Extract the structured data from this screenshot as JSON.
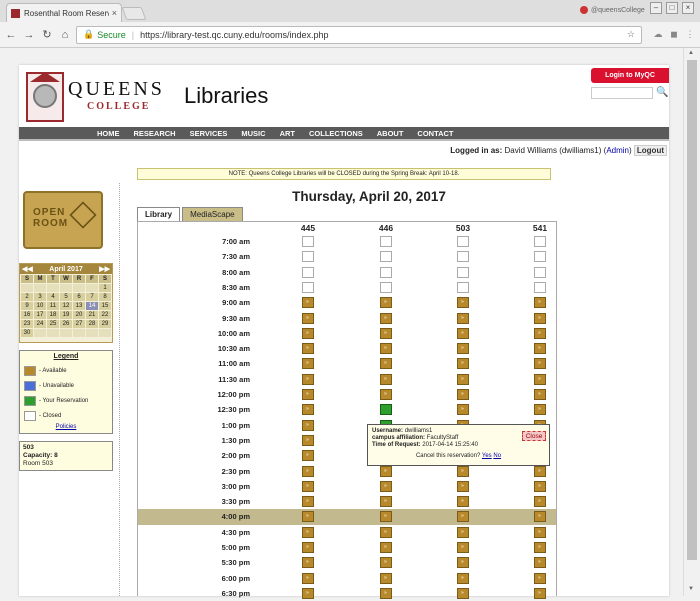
{
  "browser": {
    "tab_title": "Rosenthal Room Reservation",
    "tab_close": "×",
    "profile_name": "@queensCollege",
    "secure_label": "Secure",
    "url": "https://library-test.qc.cuny.edu/rooms/index.php",
    "icons": [
      "back-icon",
      "forward-icon",
      "reload-icon",
      "home-icon",
      "lock-icon",
      "star-icon",
      "menu-icon"
    ]
  },
  "header": {
    "logo_queens": "QUEENS",
    "logo_college": "COLLEGE",
    "site_title": "Libraries",
    "login_button": "Login to MyQC",
    "search_placeholder": ""
  },
  "nav": [
    "HOME",
    "RESEARCH",
    "SERVICES",
    "MUSIC",
    "ART",
    "COLLECTIONS",
    "ABOUT",
    "CONTACT"
  ],
  "user": {
    "logged_in_label": "Logged in as:",
    "user_name": "David Williams (dwilliams1)",
    "admin_link": "Admin",
    "logout": "Logout"
  },
  "notice": "NOTE: Queens College Libraries will be CLOSED during the Spring Break: April 10-18.",
  "open_room": {
    "line1": "OPEN",
    "line2": "ROOM"
  },
  "calendar": {
    "month_label": "April 2017",
    "prev": "◀◀",
    "next": "▶▶",
    "dow": [
      "S",
      "M",
      "T",
      "W",
      "R",
      "F",
      "S"
    ],
    "weeks": [
      [
        "",
        "",
        "",
        "",
        "",
        "",
        "1"
      ],
      [
        "2",
        "3",
        "4",
        "5",
        "6",
        "7",
        "8"
      ],
      [
        "9",
        "10",
        "11",
        "12",
        "13",
        "14",
        "15"
      ],
      [
        "16",
        "17",
        "18",
        "19",
        "20",
        "21",
        "22"
      ],
      [
        "23",
        "24",
        "25",
        "26",
        "27",
        "28",
        "29"
      ],
      [
        "30",
        "",
        "",
        "",
        "",
        "",
        ""
      ]
    ],
    "today": "14"
  },
  "legend": {
    "title": "Legend",
    "items": [
      {
        "label": "- Available",
        "color": "#b8892b"
      },
      {
        "label": "- Unavailable",
        "color": "#4a6fd8"
      },
      {
        "label": "- Your Reservation",
        "color": "#2e9e2e"
      },
      {
        "label": "- Closed",
        "color": "#ffffff"
      }
    ],
    "policies_link": "Policies"
  },
  "room_info": {
    "room": "503",
    "capacity": "Capacity: 8",
    "location": "Room 503"
  },
  "date_heading": "Thursday, April 20, 2017",
  "tabs": [
    {
      "label": "Library",
      "active": true
    },
    {
      "label": "MediaScape",
      "active": false
    }
  ],
  "rooms": [
    "445",
    "446",
    "503",
    "541"
  ],
  "slots": [
    {
      "time": "7:00 am",
      "states": [
        "closed",
        "closed",
        "closed",
        "closed"
      ]
    },
    {
      "time": "7:30 am",
      "states": [
        "closed",
        "closed",
        "closed",
        "closed"
      ]
    },
    {
      "time": "8:00 am",
      "states": [
        "closed",
        "closed",
        "closed",
        "closed"
      ]
    },
    {
      "time": "8:30 am",
      "states": [
        "closed",
        "closed",
        "closed",
        "closed"
      ]
    },
    {
      "time": "9:00 am",
      "states": [
        "available",
        "available",
        "available",
        "available"
      ]
    },
    {
      "time": "9:30 am",
      "states": [
        "available",
        "available",
        "available",
        "available"
      ]
    },
    {
      "time": "10:00 am",
      "states": [
        "available",
        "available",
        "available",
        "available"
      ]
    },
    {
      "time": "10:30 am",
      "states": [
        "available",
        "available",
        "available",
        "available"
      ]
    },
    {
      "time": "11:00 am",
      "states": [
        "available",
        "available",
        "available",
        "available"
      ]
    },
    {
      "time": "11:30 am",
      "states": [
        "available",
        "available",
        "available",
        "available"
      ]
    },
    {
      "time": "12:00 pm",
      "states": [
        "available",
        "available",
        "available",
        "available"
      ]
    },
    {
      "time": "12:30 pm",
      "states": [
        "available",
        "mine",
        "available",
        "available"
      ]
    },
    {
      "time": "1:00 pm",
      "states": [
        "available",
        "mine",
        "available",
        "available"
      ]
    },
    {
      "time": "1:30 pm",
      "states": [
        "available",
        "mine",
        "available",
        "available"
      ]
    },
    {
      "time": "2:00 pm",
      "states": [
        "available",
        "mine",
        "available",
        "available"
      ]
    },
    {
      "time": "2:30 pm",
      "states": [
        "available",
        "available",
        "available",
        "available"
      ]
    },
    {
      "time": "3:00 pm",
      "states": [
        "available",
        "available",
        "available",
        "available"
      ]
    },
    {
      "time": "3:30 pm",
      "states": [
        "available",
        "available",
        "available",
        "available"
      ]
    },
    {
      "time": "4:00 pm",
      "states": [
        "available",
        "available",
        "available",
        "available"
      ],
      "highlight": true
    },
    {
      "time": "4:30 pm",
      "states": [
        "available",
        "available",
        "available",
        "available"
      ]
    },
    {
      "time": "5:00 pm",
      "states": [
        "available",
        "available",
        "available",
        "available"
      ]
    },
    {
      "time": "5:30 pm",
      "states": [
        "available",
        "available",
        "available",
        "available"
      ]
    },
    {
      "time": "6:00 pm",
      "states": [
        "available",
        "available",
        "available",
        "available"
      ]
    },
    {
      "time": "6:30 pm",
      "states": [
        "available",
        "available",
        "available",
        "available"
      ]
    }
  ],
  "popup": {
    "username_label": "Username:",
    "username": "dwilliams1",
    "affiliation_label": "campus affiliation:",
    "affiliation": "FacultyStaff",
    "time_label": "Time of Request:",
    "time": "2017-04-14 15:25:40",
    "cancel_question": "Cancel this reservation?",
    "yes": "Yes",
    "no": "No",
    "close": "Close"
  }
}
